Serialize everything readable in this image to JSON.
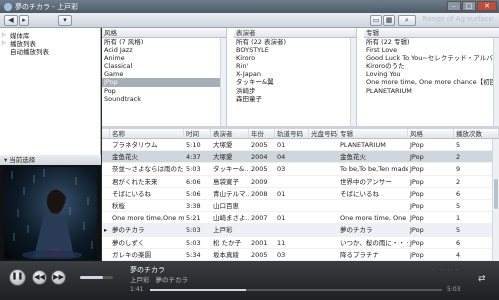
{
  "window": {
    "title": "夢のチカラ - 上戸彩",
    "controls": [
      "–",
      "□",
      "✕"
    ]
  },
  "toolbar": {
    "ghost": "Range of Ag surface"
  },
  "nav": {
    "items": [
      {
        "label": "媒体库"
      },
      {
        "label": "播放列表"
      },
      {
        "label": "自动播放列表"
      }
    ]
  },
  "browser": {
    "panes": [
      {
        "header": "风格",
        "items": [
          "所有 (7 风格)",
          "Acid Jazz",
          "Anime",
          "Classical",
          "Game",
          "JPop",
          "Pop",
          "Soundtrack"
        ],
        "selected": 5
      },
      {
        "header": "表演者",
        "items": [
          "所有 (22 表演者)",
          "BOYSTYLE",
          "Kiroro",
          "Rin'",
          "X-Japan",
          "タッキー&翼",
          "浜崎步",
          "森田童子"
        ],
        "selected": -1
      },
      {
        "header": "专辑",
        "items": [
          "所有 (22 专辑)",
          "First Love",
          "Good Luck To You~セレクテッド・アルバ…",
          "Kiroroのうた",
          "Loving You",
          "One more time, One more chance【初回…",
          "PLANETARIUM"
        ],
        "selected": -1
      }
    ]
  },
  "table": {
    "columns": [
      "名称",
      "时间",
      "表演者",
      "年份",
      "轨道号码",
      "光盘号码",
      "专辑",
      "风格",
      "播放次数"
    ],
    "rows": [
      {
        "name": "プラネタリウム",
        "time": "5:10",
        "artist": "大塚愛",
        "year": "2005",
        "track": "01",
        "disc": "",
        "album": "PLANETARIUM",
        "genre": "JPop",
        "plays": "5"
      },
      {
        "name": "金鱼花火",
        "time": "4:37",
        "artist": "大塚愛",
        "year": "2004",
        "track": "04",
        "disc": "",
        "album": "金鱼花火",
        "genre": "JPop",
        "plays": "2"
      },
      {
        "name": "奈並～さよならは雨のた…",
        "time": "5:03",
        "artist": "タッキー&…",
        "year": "2005",
        "track": "03",
        "disc": "",
        "album": "To be,To be,Ten made …",
        "genre": "JPop",
        "plays": "9"
      },
      {
        "name": "君がくれた未来",
        "time": "6:06",
        "artist": "島袋寛子",
        "year": "2009",
        "track": "",
        "disc": "",
        "album": "世界中のアンサー",
        "genre": "JPop",
        "plays": "2"
      },
      {
        "name": "そばにいるね",
        "time": "5:06",
        "artist": "青山テルマ…",
        "year": "2008",
        "track": "01",
        "disc": "",
        "album": "そばにいるね",
        "genre": "JPop",
        "plays": "6"
      },
      {
        "name": "秋桜",
        "time": "3:38",
        "artist": "山口百恵",
        "year": "",
        "track": "",
        "disc": "",
        "album": "",
        "genre": "JPop",
        "plays": "5"
      },
      {
        "name": "One more time,One more ch…",
        "time": "5:21",
        "artist": "山崎まさよ…",
        "year": "2007",
        "track": "01",
        "disc": "",
        "album": "One more time, One more…",
        "genre": "JPop",
        "plays": "1"
      },
      {
        "name": "夢のチカラ",
        "time": "5:03",
        "artist": "上戸彩",
        "year": "",
        "track": "",
        "disc": "",
        "album": "夢のチカラ",
        "genre": "JPop",
        "plays": "5"
      },
      {
        "name": "夢のしずく",
        "time": "5:03",
        "artist": "松 たか子",
        "year": "2001",
        "track": "11",
        "disc": "",
        "album": "いつか、桜の雨に・・・",
        "genre": "JPop",
        "plays": "6"
      },
      {
        "name": "ガレキの楽園",
        "time": "5:34",
        "artist": "坂本真綾",
        "year": "2005",
        "track": "03",
        "disc": "",
        "album": "降るプラチナ",
        "genre": "JPop",
        "plays": "4"
      }
    ],
    "selected_row": 1,
    "playing_row": 7
  },
  "art_panel": {
    "header": "当前选择"
  },
  "player": {
    "title": "夢のチカラ",
    "artist": "上戸彩",
    "album": "夢のチカラ",
    "elapsed": "1:41",
    "total": "5:03",
    "progress": 0.33,
    "volume": 0.7
  }
}
